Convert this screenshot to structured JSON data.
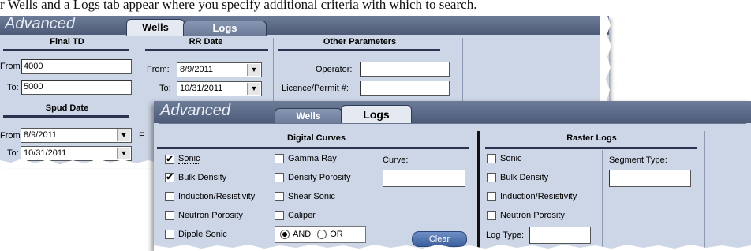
{
  "caption": "r Wells and a Logs tab appear where you specify additional criteria with which to search.",
  "back_panel": {
    "title": "Advanced",
    "tabs": [
      {
        "label": "Wells",
        "active": true
      },
      {
        "label": "Logs",
        "active": false
      }
    ],
    "final_td": {
      "title": "Final TD",
      "from_label": "From:",
      "from_value": "4000",
      "to_label": "To:",
      "to_value": "5000"
    },
    "rr_date": {
      "title": "RR Date",
      "from_label": "From:",
      "from_value": "8/9/2011",
      "to_label": "To:",
      "to_value": "10/31/2011"
    },
    "other": {
      "title": "Other Parameters",
      "operator_label": "Operator:",
      "operator_value": "",
      "licence_label": "Licence/Permit #:",
      "licence_value": ""
    },
    "spud_date": {
      "title": "Spud Date",
      "from_label": "From:",
      "from_value": "8/9/2011",
      "to_label": "To:",
      "to_value": "10/31/2011"
    },
    "partial_label": "F"
  },
  "front_panel": {
    "title": "Advanced",
    "tabs": [
      {
        "label": "Wells",
        "active": false
      },
      {
        "label": "Logs",
        "active": true
      }
    ],
    "digital": {
      "title": "Digital Curves",
      "col1": [
        {
          "label": "Sonic",
          "checked": true
        },
        {
          "label": "Bulk Density",
          "checked": true
        },
        {
          "label": "Induction/Resistivity",
          "checked": false
        },
        {
          "label": "Neutron Porosity",
          "checked": false
        },
        {
          "label": "Dipole Sonic",
          "checked": false
        }
      ],
      "col2": [
        {
          "label": "Gamma Ray",
          "checked": false
        },
        {
          "label": "Density Porosity",
          "checked": false
        },
        {
          "label": "Shear Sonic",
          "checked": false
        },
        {
          "label": "Caliper",
          "checked": false
        }
      ],
      "and_label": "AND",
      "or_label": "OR",
      "selected": "AND",
      "curve_label": "Curve:",
      "curve_value": "",
      "clear_label": "Clear"
    },
    "raster": {
      "title": "Raster Logs",
      "items": [
        {
          "label": "Sonic",
          "checked": false
        },
        {
          "label": "Bulk Density",
          "checked": false
        },
        {
          "label": "Induction/Resistivity",
          "checked": false
        },
        {
          "label": "Neutron Porosity",
          "checked": false
        }
      ],
      "log_type_label": "Log Type:",
      "log_type_value": "",
      "segment_label": "Segment Type:",
      "segment_value": ""
    }
  },
  "colors": {
    "panel_bg": "#cdd6e6",
    "header": "#5a6884",
    "accent": "#27334f",
    "button": "#4f72b0"
  }
}
